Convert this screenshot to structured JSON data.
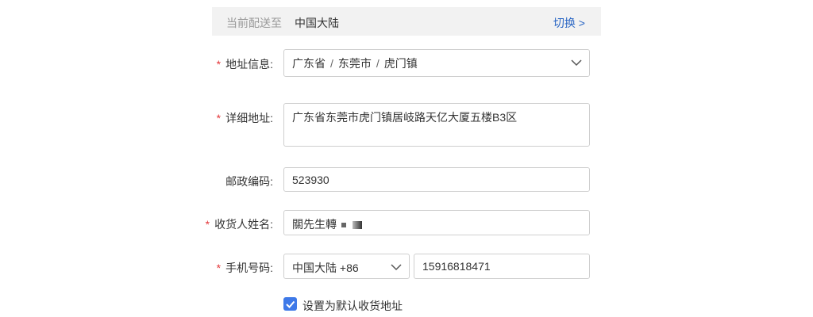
{
  "region": {
    "prefix": "当前配送至",
    "value": "中国大陆",
    "switch_label": "切换 >"
  },
  "form": {
    "required_mark": "*",
    "address_info": {
      "label": "地址信息:",
      "province": "广东省",
      "city": "东莞市",
      "district": "虎门镇",
      "separator": "/"
    },
    "detail_address": {
      "label": "详细地址:",
      "value": "广东省东莞市虎门镇居岐路天亿大厦五楼B3区"
    },
    "postal_code": {
      "label": "邮政编码:",
      "value": "523930"
    },
    "recipient_name": {
      "label": "收货人姓名:",
      "value": "關先生轉"
    },
    "phone": {
      "label": "手机号码:",
      "country_code": "中国大陆 +86",
      "number": "15916818471"
    },
    "default_checkbox": {
      "label": "设置为默认收货地址",
      "checked": true
    }
  },
  "colors": {
    "accent": "#3e79e8",
    "required": "#e4393c",
    "link": "#2a66c4",
    "region_bg": "#f2f2f2"
  },
  "icons": {
    "dropdown": "chevron-down-icon",
    "checkbox": "checkmark-icon"
  }
}
